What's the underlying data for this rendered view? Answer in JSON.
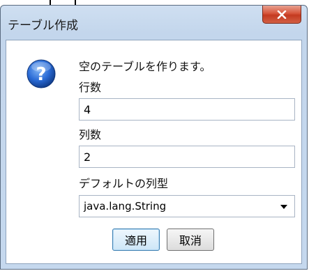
{
  "window": {
    "title": "テーブル作成",
    "close_label": "x"
  },
  "dialog": {
    "message": "空のテーブルを作ります。",
    "rows_label": "行数",
    "rows_value": "4",
    "cols_label": "列数",
    "cols_value": "2",
    "type_label": "デフォルトの列型",
    "type_value": "java.lang.String"
  },
  "buttons": {
    "apply": "適用",
    "cancel": "取消"
  },
  "colors": {
    "title_bar": "#c5d8ee",
    "close_button": "#c43a20",
    "help_icon": "#2a6bd6"
  }
}
